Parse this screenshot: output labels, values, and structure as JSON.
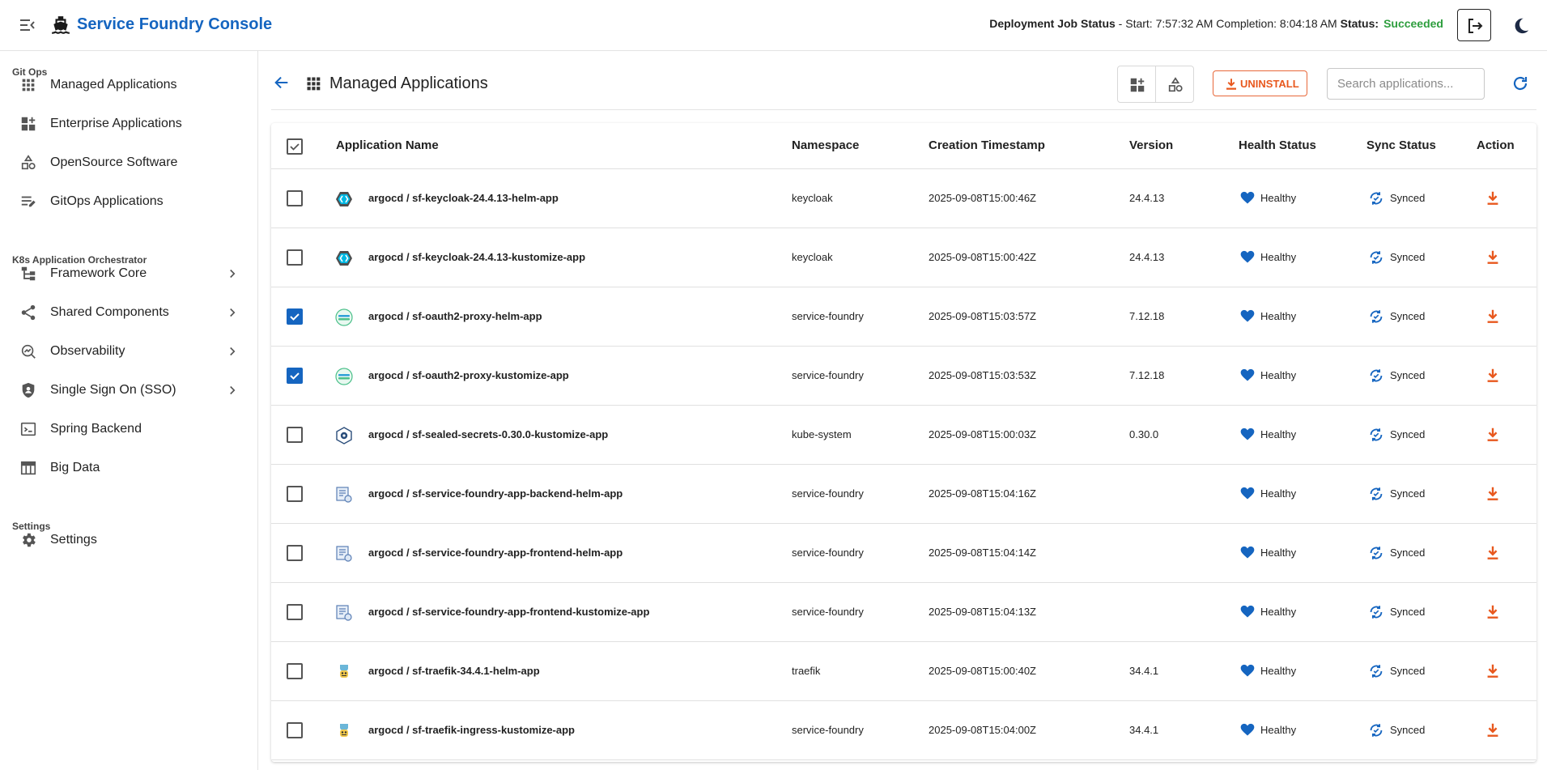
{
  "header": {
    "app_title": "Service Foundry Console",
    "deploy_label": "Deployment Job Status",
    "deploy_times": " - Start: 7:57:32 AM Completion: 8:04:18 AM ",
    "status_label": "Status:",
    "status_value": "Succeeded",
    "status_color": "#2e9e3e"
  },
  "sidebar": {
    "sections": [
      {
        "label": "Git Ops"
      },
      {
        "label": "K8s Application Orchestrator"
      },
      {
        "label": "Settings"
      }
    ],
    "items": [
      {
        "label": "Managed Applications",
        "icon": "apps-grid-icon"
      },
      {
        "label": "Enterprise Applications",
        "icon": "widgets-add-icon"
      },
      {
        "label": "OpenSource Software",
        "icon": "shapes-icon"
      },
      {
        "label": "GitOps Applications",
        "icon": "edit-list-icon"
      },
      {
        "label": "Framework Core",
        "icon": "account-tree-icon"
      },
      {
        "label": "Shared Components",
        "icon": "share-icon"
      },
      {
        "label": "Observability",
        "icon": "search-insights-icon"
      },
      {
        "label": "Single Sign On (SSO)",
        "icon": "shield-person-icon"
      },
      {
        "label": "Spring Backend",
        "icon": "terminal-icon"
      },
      {
        "label": "Big Data",
        "icon": "table-icon"
      },
      {
        "label": "Settings",
        "icon": "gear-icon"
      }
    ]
  },
  "main": {
    "title": "Managed Applications",
    "uninstall_label": "UNINSTALL",
    "search_placeholder": "Search applications...",
    "accent_color": "#1565c0",
    "danger_color": "#e8581e"
  },
  "table": {
    "headers": [
      "Application Name",
      "Namespace",
      "Creation Timestamp",
      "Version",
      "Health Status",
      "Sync Status",
      "Action"
    ],
    "rows": [
      {
        "name": "argocd / sf-keycloak-24.4.13-helm-app",
        "namespace": "keycloak",
        "created": "2025-09-08T15:00:46Z",
        "version": "24.4.13",
        "health": "Healthy",
        "sync": "Synced",
        "selected": false,
        "icon": "keycloak-logo-icon"
      },
      {
        "name": "argocd / sf-keycloak-24.4.13-kustomize-app",
        "namespace": "keycloak",
        "created": "2025-09-08T15:00:42Z",
        "version": "24.4.13",
        "health": "Healthy",
        "sync": "Synced",
        "selected": false,
        "icon": "keycloak-logo-icon"
      },
      {
        "name": "argocd / sf-oauth2-proxy-helm-app",
        "namespace": "service-foundry",
        "created": "2025-09-08T15:03:57Z",
        "version": "7.12.18",
        "health": "Healthy",
        "sync": "Synced",
        "selected": true,
        "icon": "oauth2-proxy-logo-icon"
      },
      {
        "name": "argocd / sf-oauth2-proxy-kustomize-app",
        "namespace": "service-foundry",
        "created": "2025-09-08T15:03:53Z",
        "version": "7.12.18",
        "health": "Healthy",
        "sync": "Synced",
        "selected": true,
        "icon": "oauth2-proxy-logo-icon"
      },
      {
        "name": "argocd / sf-sealed-secrets-0.30.0-kustomize-app",
        "namespace": "kube-system",
        "created": "2025-09-08T15:00:03Z",
        "version": "0.30.0",
        "health": "Healthy",
        "sync": "Synced",
        "selected": false,
        "icon": "sealed-secrets-logo-icon"
      },
      {
        "name": "argocd / sf-service-foundry-app-backend-helm-app",
        "namespace": "service-foundry",
        "created": "2025-09-08T15:04:16Z",
        "version": "",
        "health": "Healthy",
        "sync": "Synced",
        "selected": false,
        "icon": "service-foundry-logo-icon"
      },
      {
        "name": "argocd / sf-service-foundry-app-frontend-helm-app",
        "namespace": "service-foundry",
        "created": "2025-09-08T15:04:14Z",
        "version": "",
        "health": "Healthy",
        "sync": "Synced",
        "selected": false,
        "icon": "service-foundry-logo-icon"
      },
      {
        "name": "argocd / sf-service-foundry-app-frontend-kustomize-app",
        "namespace": "service-foundry",
        "created": "2025-09-08T15:04:13Z",
        "version": "",
        "health": "Healthy",
        "sync": "Synced",
        "selected": false,
        "icon": "service-foundry-logo-icon"
      },
      {
        "name": "argocd / sf-traefik-34.4.1-helm-app",
        "namespace": "traefik",
        "created": "2025-09-08T15:00:40Z",
        "version": "34.4.1",
        "health": "Healthy",
        "sync": "Synced",
        "selected": false,
        "icon": "traefik-logo-icon"
      },
      {
        "name": "argocd / sf-traefik-ingress-kustomize-app",
        "namespace": "service-foundry",
        "created": "2025-09-08T15:04:00Z",
        "version": "34.4.1",
        "health": "Healthy",
        "sync": "Synced",
        "selected": false,
        "icon": "traefik-logo-icon"
      }
    ]
  }
}
